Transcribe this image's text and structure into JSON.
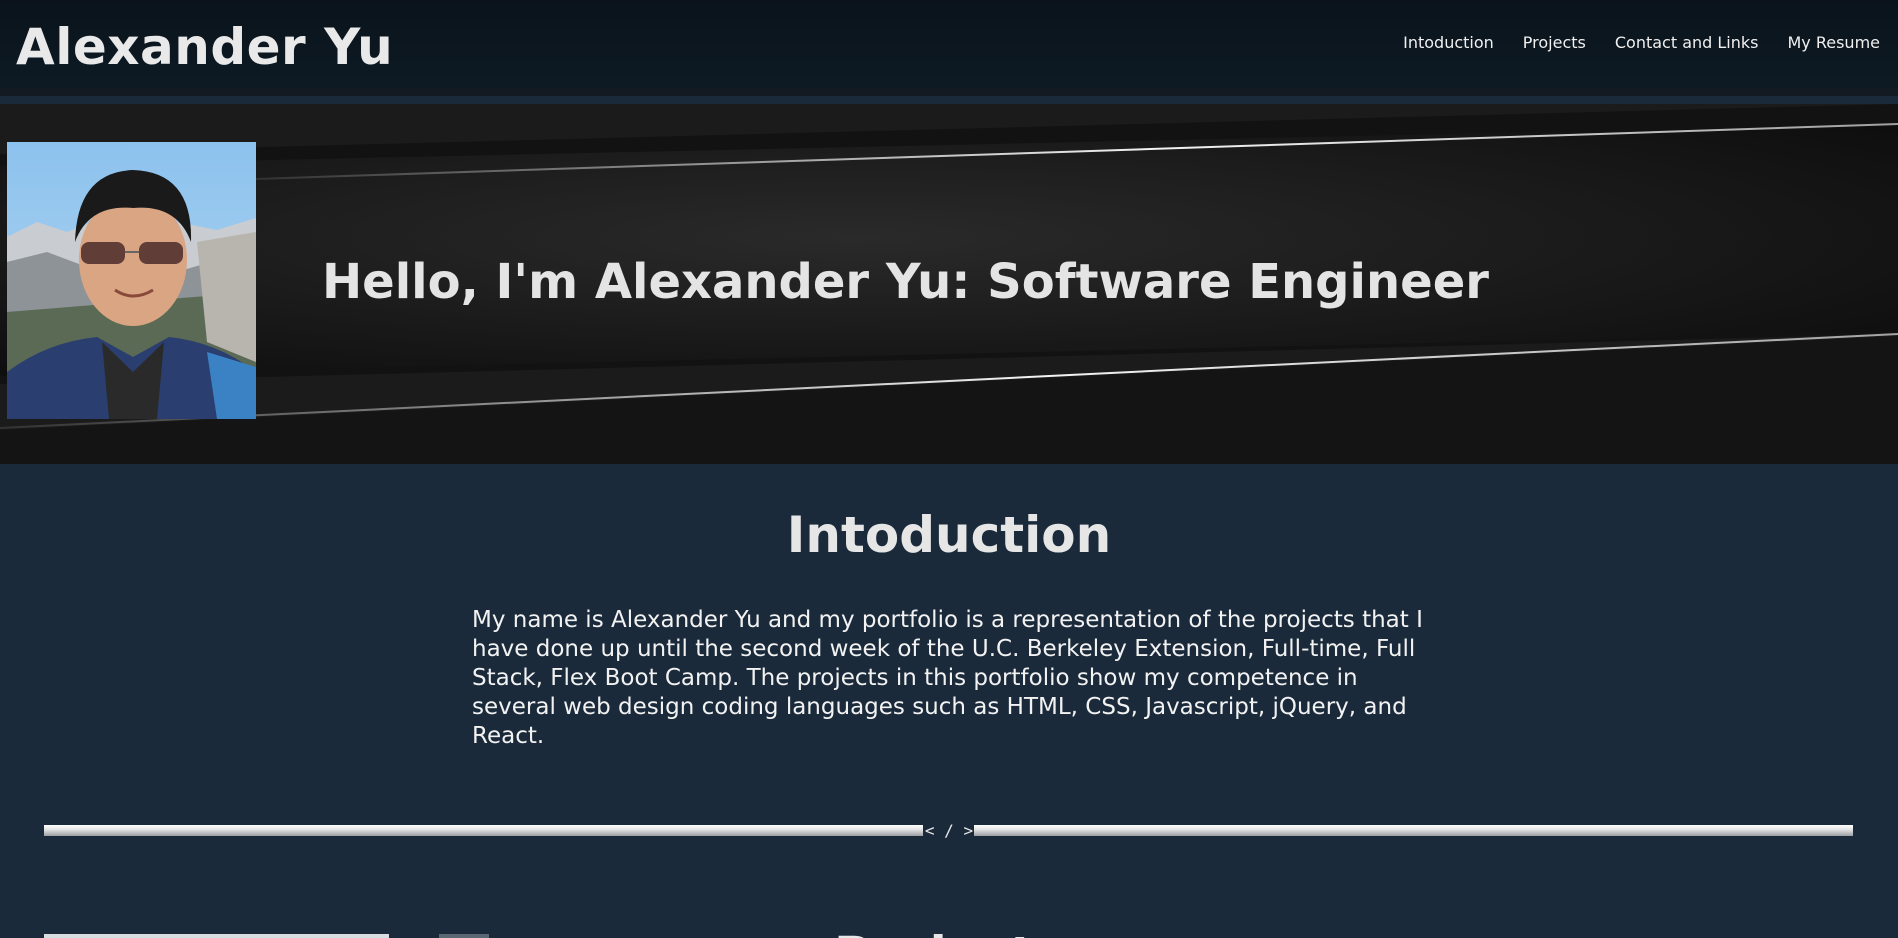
{
  "header": {
    "site_title": "Alexander Yu",
    "nav": [
      {
        "label": "Intoduction"
      },
      {
        "label": "Projects"
      },
      {
        "label": "Contact and Links"
      },
      {
        "label": "My Resume"
      }
    ]
  },
  "hero": {
    "heading": "Hello, I'm Alexander Yu: Software Engineer",
    "photo_icon": "profile-photo"
  },
  "intro": {
    "title": "Intoduction",
    "text": "My name is Alexander Yu and my portfolio is a representation of the projects that I have done up until the second week of the U.C. Berkeley Extension, Full-time, Full Stack, Flex Boot Camp. The projects in this portfolio show my competence in several web design coding languages such as HTML, CSS, Javascript, jQuery, and React."
  },
  "divider": {
    "code_symbol": "< / >"
  },
  "projects": {
    "title": "Projects"
  },
  "colors": {
    "page_bg": "#1a2a3a",
    "header_bg": "#0a131b",
    "hero_bg": "#151515",
    "text": "#e8e8e8"
  }
}
